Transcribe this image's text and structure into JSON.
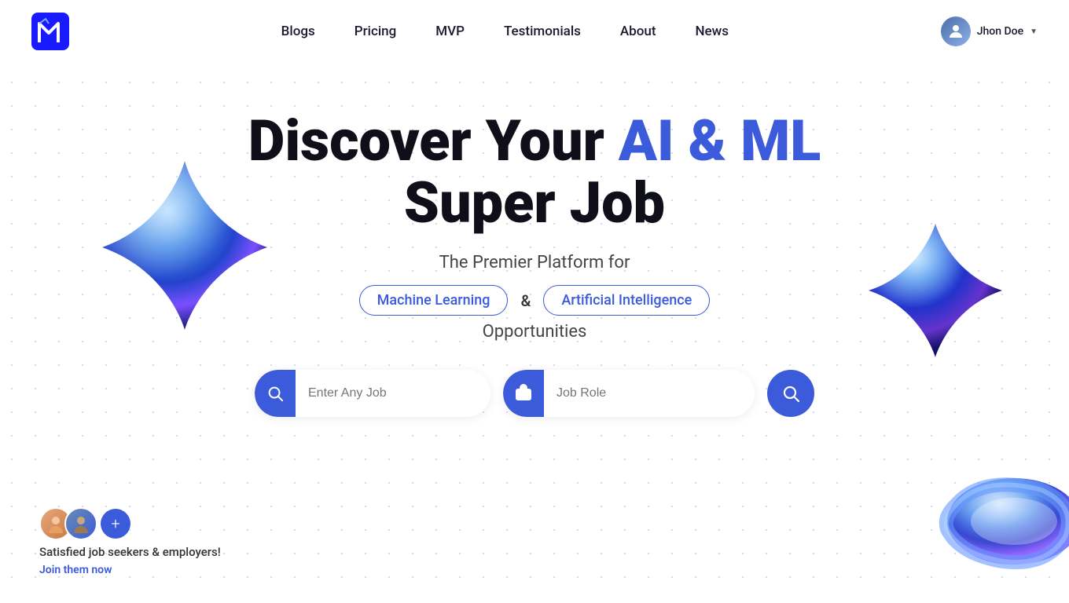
{
  "nav": {
    "logo_alt": "Logo",
    "links": [
      {
        "label": "Blogs",
        "href": "#"
      },
      {
        "label": "Pricing",
        "href": "#"
      },
      {
        "label": "MVP",
        "href": "#"
      },
      {
        "label": "Testimonials",
        "href": "#"
      },
      {
        "label": "About",
        "href": "#"
      },
      {
        "label": "News",
        "href": "#"
      }
    ],
    "user": {
      "name": "Jhon Doe",
      "avatar_alt": "User Avatar"
    }
  },
  "hero": {
    "title_part1": "Discover Your ",
    "title_highlight": "AI & ML",
    "title_part2": "Super Job",
    "subtitle": "The Premier Platform for",
    "tag1": "Machine Learning",
    "separator": "&",
    "tag2": "Artificial Intelligence",
    "opportunities": "Opportunities"
  },
  "search": {
    "job_placeholder": "Enter Any Job",
    "role_placeholder": "Job Role",
    "submit_label": "Search"
  },
  "social_proof": {
    "text": "Satisfied job seekers & employers!",
    "link": "Join them now"
  }
}
